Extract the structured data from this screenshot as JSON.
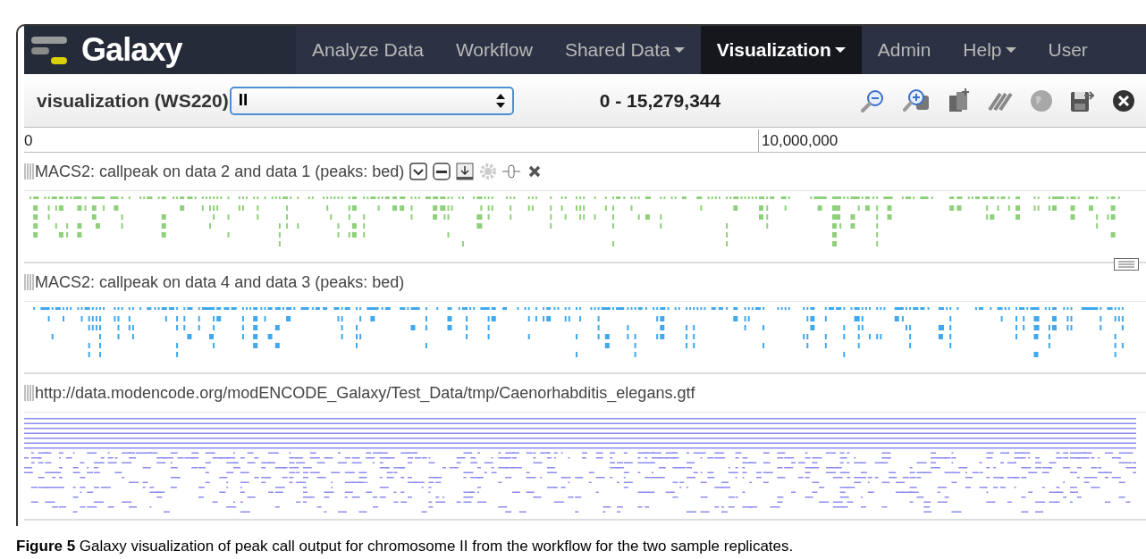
{
  "brand": "Galaxy",
  "nav": [
    {
      "label": "Analyze Data",
      "dropdown": false,
      "selected": false
    },
    {
      "label": "Workflow",
      "dropdown": false,
      "selected": false
    },
    {
      "label": "Shared Data",
      "dropdown": true,
      "selected": false
    },
    {
      "label": "Visualization",
      "dropdown": true,
      "selected": true
    },
    {
      "label": "Admin",
      "dropdown": false,
      "selected": false
    },
    {
      "label": "Help",
      "dropdown": true,
      "selected": false
    },
    {
      "label": "User",
      "dropdown": false,
      "selected": false
    }
  ],
  "toolbar": {
    "title": "visualization (WS220)",
    "chromosome": "II",
    "range": "0 - 15,279,344"
  },
  "ruler": [
    "0",
    "10,000,000"
  ],
  "tracks": [
    {
      "title": "MACS2: callpeak on data 2 and data 1 (peaks: bed)",
      "kind": "peaks",
      "color": "#8fd07a",
      "controls_shown": true
    },
    {
      "title": "MACS2: callpeak on data 4 and data 3 (peaks: bed)",
      "kind": "peaks",
      "color": "#3fa8ee",
      "controls_shown": false
    },
    {
      "title": "http://data.modencode.org/modENCODE_Galaxy/Test_Data/tmp/Caenorhabditis_elegans.gtf",
      "kind": "genes",
      "color": "#8c8cf0",
      "controls_shown": false
    }
  ],
  "caption": "**Figure 5** Galaxy visualization of peak call output for chromosome II from the workflow for the two sample replicates."
}
